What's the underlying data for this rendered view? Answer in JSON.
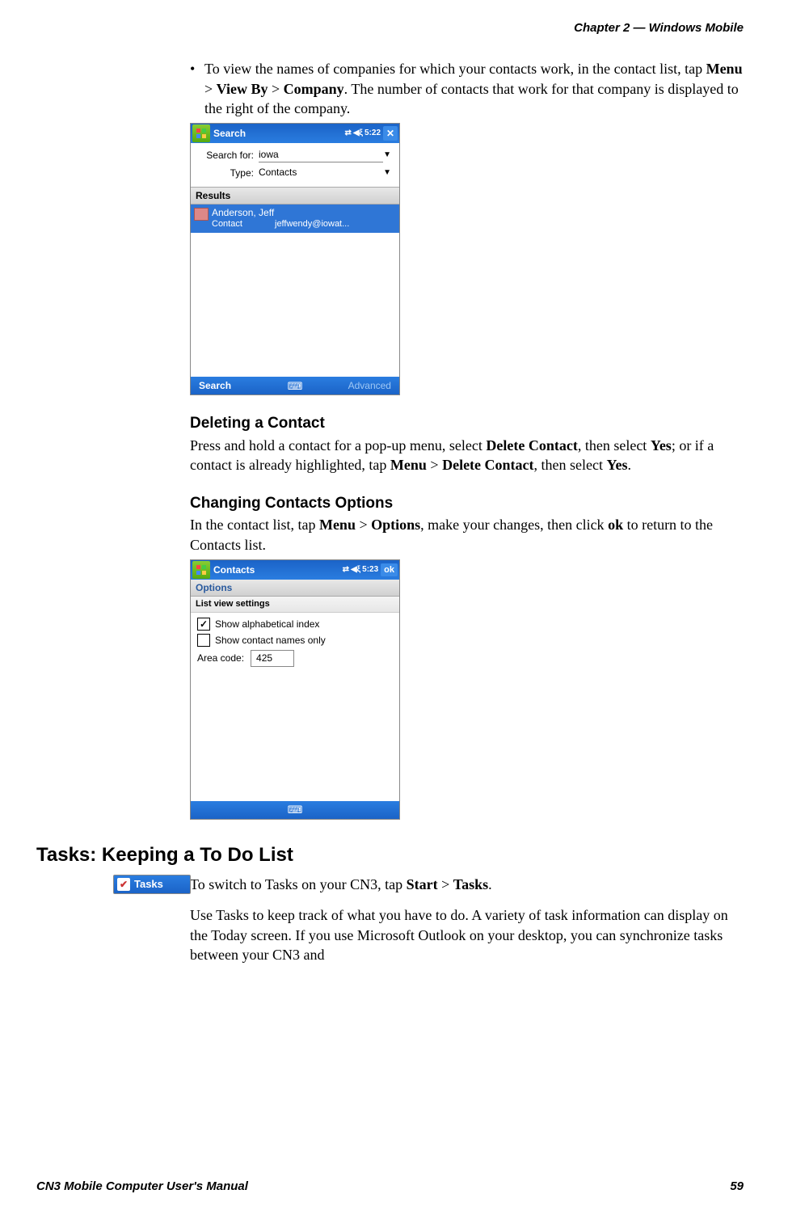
{
  "header": {
    "chapter": "Chapter 2 —  Windows Mobile"
  },
  "bullet1": {
    "pre": "To view the names of companies for which your contacts work, in the contact list, tap ",
    "b1": "Menu",
    "gt1": " > ",
    "b2": "View By",
    "gt2": " > ",
    "b3": "Company",
    "post": ". The number of contacts that work for that company is displayed to the right of the company."
  },
  "shot1": {
    "title": "Search",
    "time": "5:22",
    "search_for_label": "Search for:",
    "search_for_value": "iowa",
    "type_label": "Type:",
    "type_value": "Contacts",
    "results_label": "Results",
    "result_name": "Anderson, Jeff",
    "result_type": "Contact",
    "result_detail": "jeffwendy@iowat...",
    "bottom_left": "Search",
    "bottom_right": "Advanced"
  },
  "sub1": {
    "heading": "Deleting a Contact",
    "t1": "Press and hold a contact for a pop-up menu, select ",
    "b1": "Delete Contact",
    "t2": ", then select ",
    "b2": "Yes",
    "t3": "; or if a contact is already highlighted, tap ",
    "b3": "Menu",
    "t4": " > ",
    "b4": "Delete Contact",
    "t5": ", then select ",
    "b5": "Yes",
    "t6": "."
  },
  "sub2": {
    "heading": "Changing Contacts Options",
    "t1": "In the contact list, tap ",
    "b1": "Menu",
    "t2": " > ",
    "b2": "Options",
    "t3": ", make your changes, then click ",
    "b3": "ok",
    "t4": " to return to the Contacts list."
  },
  "shot2": {
    "title": "Contacts",
    "time": "5:23",
    "ok": "ok",
    "options_label": "Options",
    "section_label": "List view settings",
    "cb1_label": "Show alphabetical index",
    "cb2_label": "Show contact names only",
    "area_label": "Area code:",
    "area_value": "425"
  },
  "section2": {
    "heading": "Tasks: Keeping a To Do List",
    "pill_label": "Tasks",
    "p1_a": "To switch to Tasks on your CN3, tap ",
    "p1_b1": "Start",
    "p1_b": " > ",
    "p1_b2": "Tasks",
    "p1_c": ".",
    "p2": "Use Tasks to keep track of what you have to do. A variety of task information can display on the Today screen. If you use Microsoft Outlook on your desktop, you can synchronize tasks between your CN3 and"
  },
  "footer": {
    "left": "CN3 Mobile Computer User's Manual",
    "right": "59"
  }
}
